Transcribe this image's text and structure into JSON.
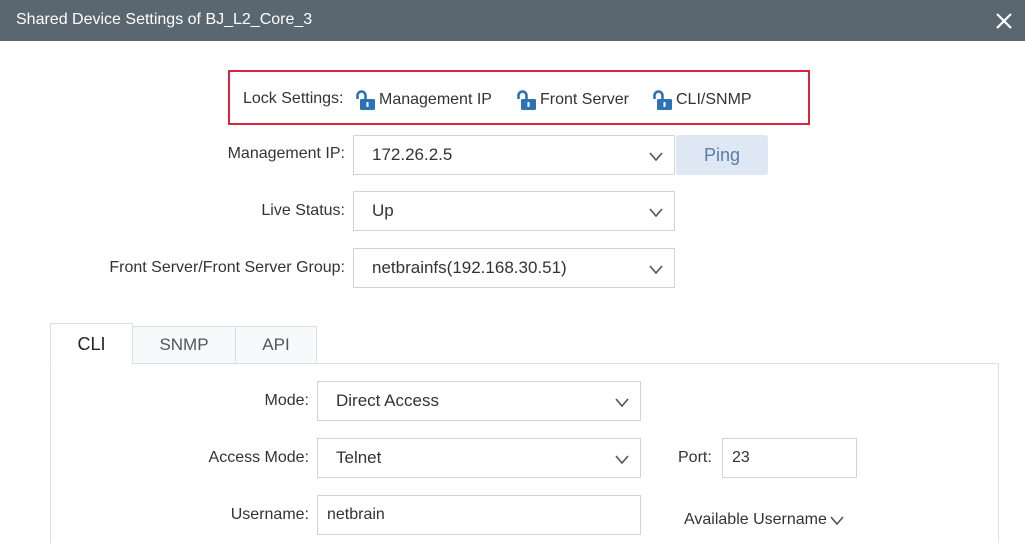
{
  "window": {
    "title": "Shared Device Settings of BJ_L2_Core_3"
  },
  "icons": {
    "close": "close-icon",
    "lock": "unlock-icon",
    "dropdown": "chevron-down-icon"
  },
  "lock_settings": {
    "label": "Lock Settings:",
    "items": [
      "Management IP",
      "Front Server",
      "CLI/SNMP"
    ]
  },
  "management_ip": {
    "label": "Management IP:",
    "value": "172.26.2.5",
    "ping_label": "Ping"
  },
  "live_status": {
    "label": "Live Status:",
    "value": "Up"
  },
  "front_server": {
    "label": "Front Server/Front Server Group:",
    "value": "netbrainfs(192.168.30.51)"
  },
  "tabs": [
    "CLI",
    "SNMP",
    "API"
  ],
  "cli": {
    "mode": {
      "label": "Mode:",
      "value": "Direct Access"
    },
    "access_mode": {
      "label": "Access Mode:",
      "value": "Telnet"
    },
    "port": {
      "label": "Port:",
      "value": "23"
    },
    "username": {
      "label": "Username:",
      "value": "netbrain"
    },
    "available_username": "Available Username"
  },
  "colors": {
    "titlebar": "#5a6670",
    "highlight_border": "#d9253d",
    "lock_icon": "#2d72b5",
    "ping_bg": "#dde8f4"
  }
}
